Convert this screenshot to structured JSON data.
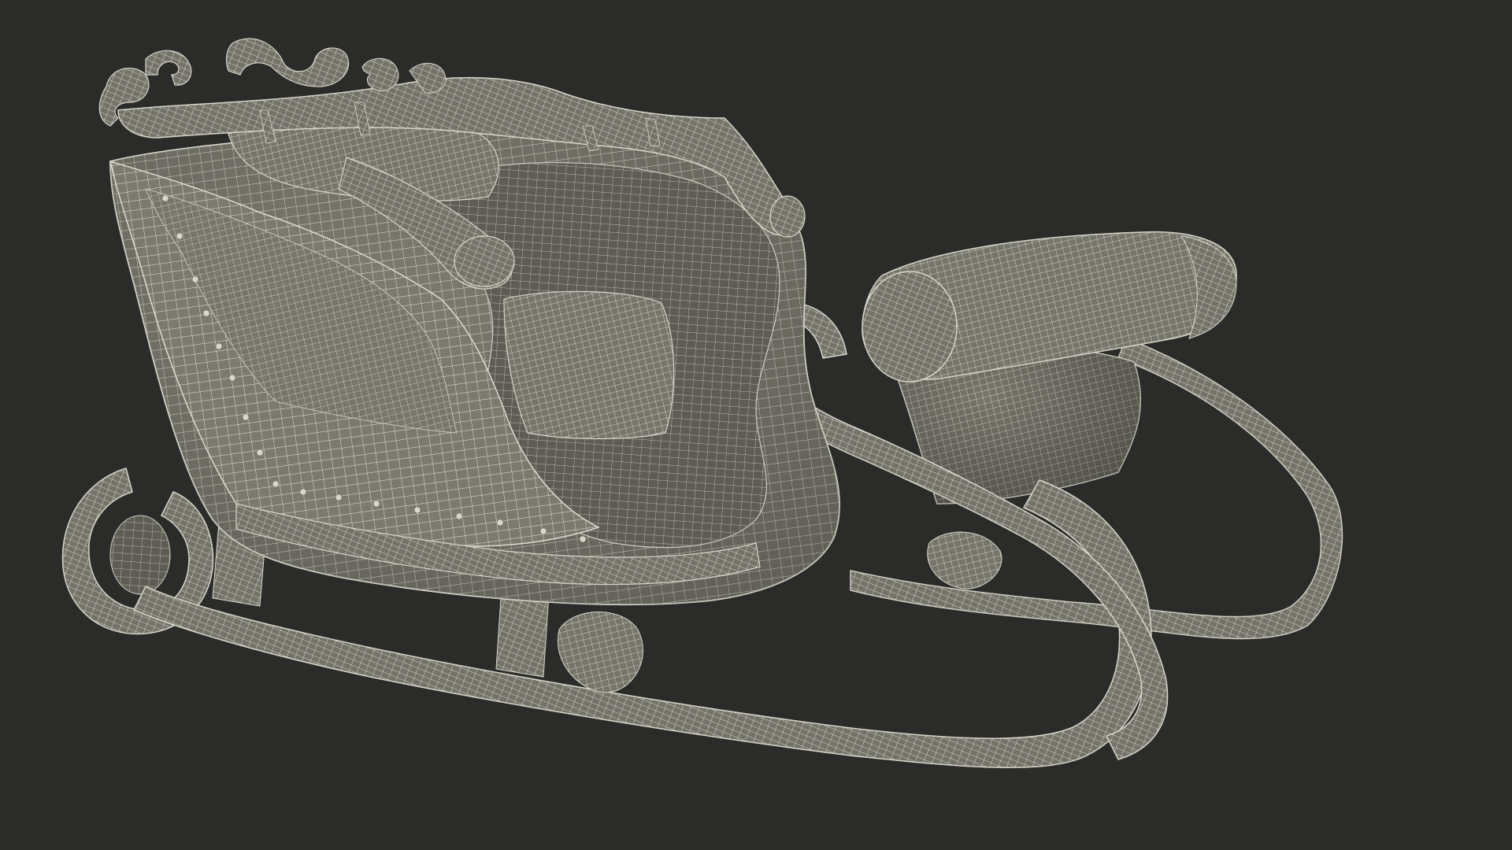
{
  "viewport": {
    "background": "#2b2b29",
    "render_mode": "wireframe-on-shaded"
  },
  "model": {
    "subject": "sleigh",
    "surface_color": "#7d7c72",
    "wire_color": "#e8e6da",
    "parts": [
      "back-scroll-crest",
      "seat-body",
      "seat-back-cushion",
      "seat-cushion",
      "side-panel",
      "side-rivets",
      "armrest",
      "front-footrest",
      "front-scroll-handle",
      "runner-near",
      "runner-far",
      "rear-curl"
    ]
  }
}
